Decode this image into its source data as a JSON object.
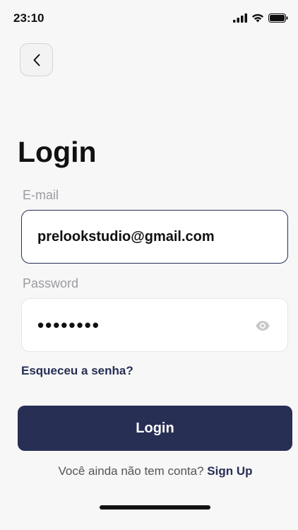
{
  "status_bar": {
    "time": "23:10",
    "icons": [
      "signal-icon",
      "wifi-icon",
      "battery-icon"
    ]
  },
  "header": {
    "back_icon": "chevron-left-icon"
  },
  "title": "Login",
  "email": {
    "label": "E-mail",
    "value": "prelookstudio@gmail.com"
  },
  "password": {
    "label": "Password",
    "value": "12345678",
    "toggle_icon": "eye-icon"
  },
  "forgot_password": "Esqueceu a senha?",
  "login_button": "Login",
  "signup": {
    "prompt": "Você ainda não tem conta?",
    "link": "Sign Up"
  },
  "colors": {
    "primary": "#272f55",
    "background": "#f7f7f7",
    "label": "#9a9aa2"
  }
}
